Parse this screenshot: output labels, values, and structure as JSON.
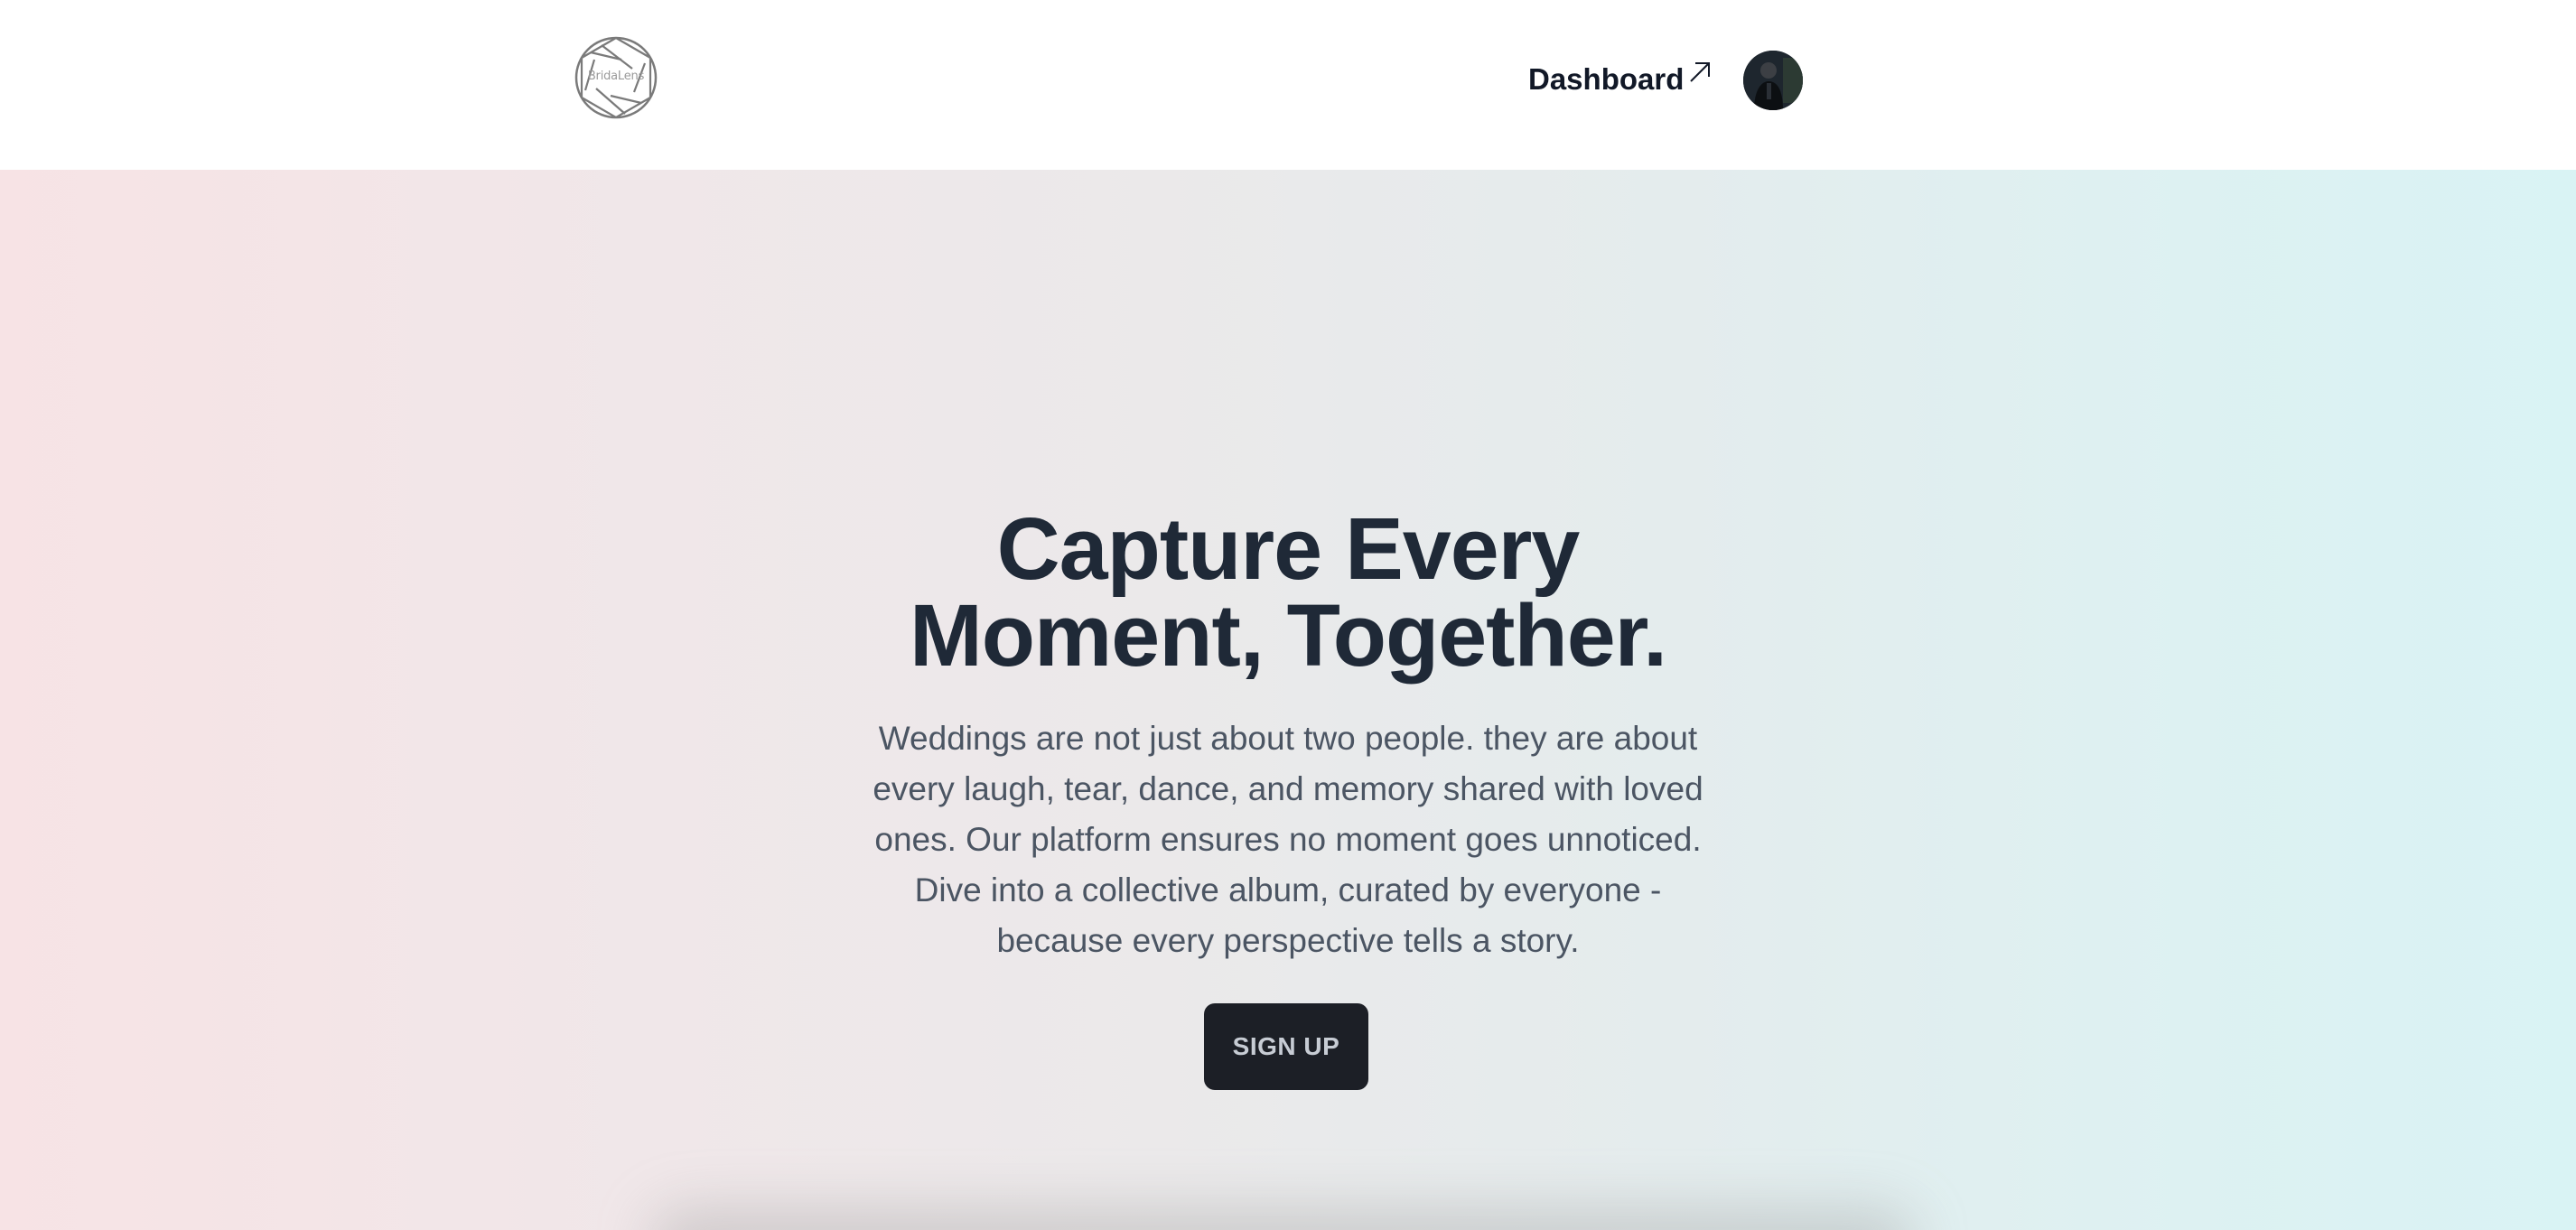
{
  "header": {
    "logo_text": "BridaLens",
    "nav_link_label": "Dashboard",
    "nav_link_icon": "arrow-up-right-icon",
    "avatar_icon": "user-avatar"
  },
  "hero": {
    "title_line1": "Capture Every",
    "title_line2": "Moment, Together.",
    "description": "Weddings are not just about two people. they are about every laugh, tear, dance, and memory shared with loved ones. Our platform ensures no moment goes unnoticed. Dive into a collective album, curated by everyone - because every perspective tells a story.",
    "cta_label": "SIGN UP"
  },
  "colors": {
    "heading": "#1f2937",
    "body_text": "#4b5563",
    "button_bg": "#1c1f26",
    "button_text": "#c7ccd4",
    "gradient_left": "#f7e3e5",
    "gradient_right": "#d9f3f4"
  }
}
